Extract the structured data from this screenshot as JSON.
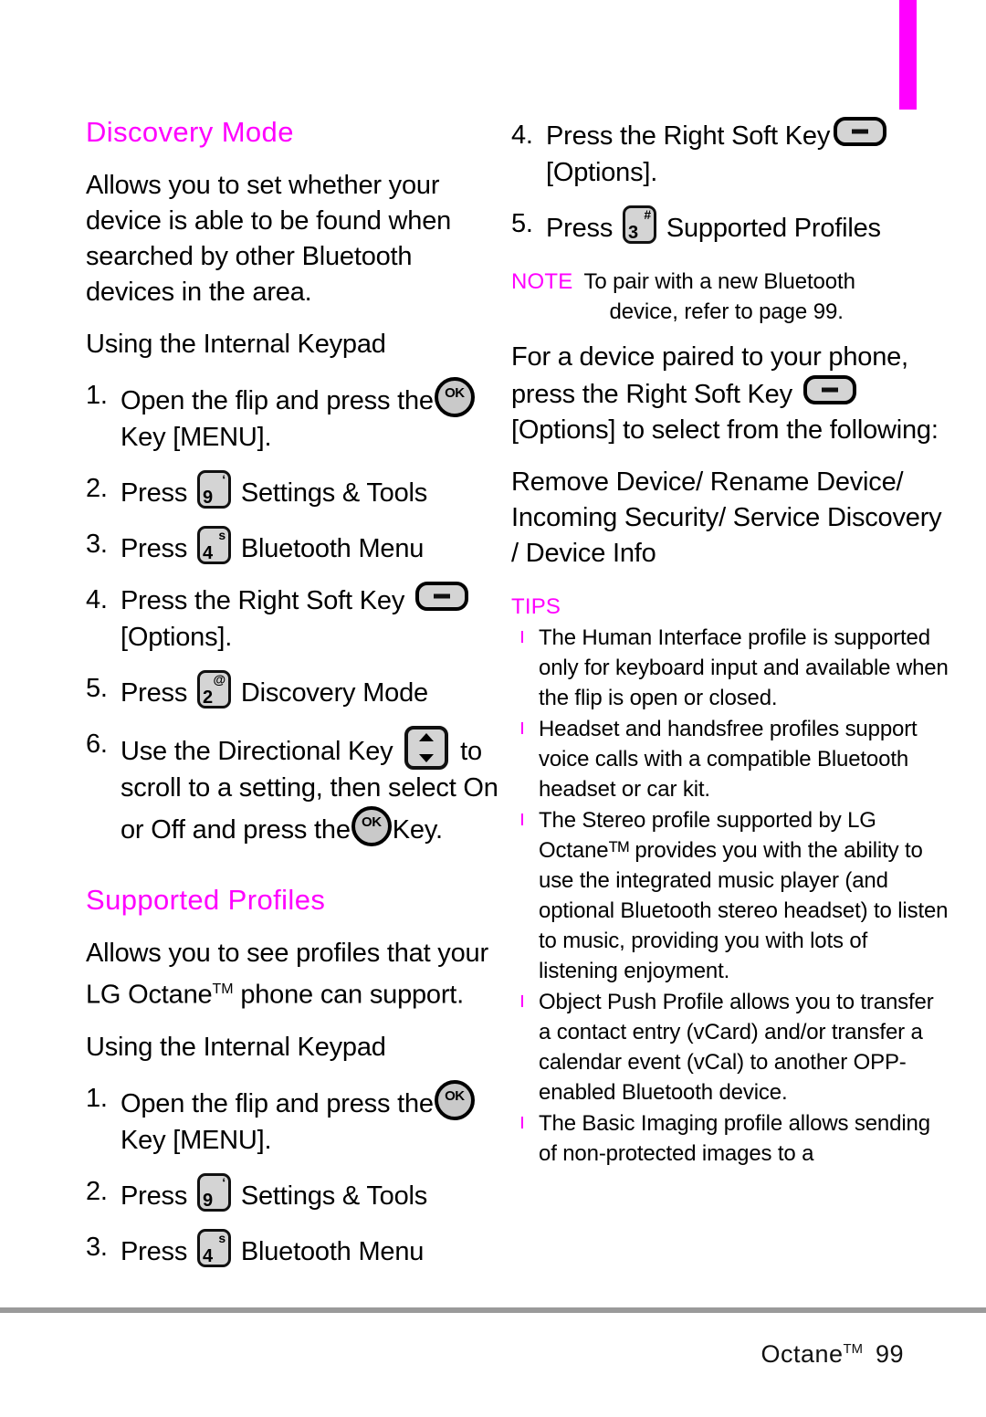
{
  "page": {
    "edge_tab_color": "#ff00ff",
    "accent_color": "#ff00ff",
    "text_color": "#000000"
  },
  "left_column": {
    "heading_1": "Discovery Mode",
    "intro_1": "Allows you to set whether your device is able to be found when searched by other Bluetooth devices in the area.",
    "subheading_1": "Using the Internal Keypad",
    "steps_1": [
      {
        "num": "1.",
        "text_before": "Open the flip and press the",
        "icon": "ok-key-icon",
        "icon_label": "OK",
        "text_after": "Key [MENU]."
      },
      {
        "num": "2.",
        "text_before": "Press",
        "icon": "number-key-icon",
        "key_digit": "9",
        "key_superscript": "‘",
        "text_after": "Settings & Tools"
      },
      {
        "num": "3.",
        "text_before": "Press",
        "icon": "number-key-icon",
        "key_digit": "4",
        "key_superscript": "s",
        "text_after": "Bluetooth Menu"
      },
      {
        "num": "4.",
        "text_before": "Press the Right Soft Key",
        "icon": "right-soft-key-icon",
        "text_after": "[Options]."
      },
      {
        "num": "5.",
        "text_before": "Press",
        "icon": "number-key-icon",
        "key_digit": "2",
        "key_superscript": "@",
        "text_after": "Discovery Mode"
      },
      {
        "num": "6.",
        "text_before": "Use the Directional Key",
        "icon": "directional-key-icon",
        "text_after": "to scroll to a setting, then select On or Off and press the",
        "icon_2": "ok-key-icon",
        "icon_2_label": "OK",
        "text_end": "Key."
      }
    ],
    "heading_2": "Supported Profiles",
    "intro_2_a": "Allows you to see profiles that your LG Octane",
    "intro_2_tm": "TM",
    "intro_2_b": " phone can support.",
    "subheading_2": "Using the Internal Keypad",
    "steps_2": [
      {
        "num": "1.",
        "text_before": "Open the flip and press the",
        "icon": "ok-key-icon",
        "icon_label": "OK",
        "text_after": "Key [MENU]."
      },
      {
        "num": "2.",
        "text_before": "Press",
        "icon": "number-key-icon",
        "key_digit": "9",
        "key_superscript": "‘",
        "text_after": "Settings & Tools"
      },
      {
        "num": "3.",
        "text_before": "Press",
        "icon": "number-key-icon",
        "key_digit": "4",
        "key_superscript": "s",
        "text_after": "Bluetooth Menu"
      }
    ]
  },
  "right_column": {
    "steps_continued": [
      {
        "num": "4.",
        "text_before": "Press the Right Soft Key",
        "icon": "right-soft-key-icon",
        "text_after": "[Options]."
      },
      {
        "num": "5.",
        "text_before": "Press",
        "icon": "number-key-icon",
        "key_digit": "3",
        "key_superscript": "#",
        "text_after": "Supported Profiles"
      }
    ],
    "note": {
      "label": "NOTE",
      "line_1": "To pair with a new Bluetooth",
      "line_2": "device, refer to page 99."
    },
    "paired_paragraph_a": "For a device paired to your phone, press the Right Soft Key",
    "paired_icon": "right-soft-key-icon",
    "paired_paragraph_b": "[Options] to select from the following:",
    "options_list": "Remove Device/ Rename Device/ Incoming Security/ Service Discovery / Device Info",
    "tips": {
      "label": "TIPS",
      "items": [
        "The Human Interface profile is supported only for keyboard input and available when the flip is open or closed.",
        "Headset and handsfree profiles support voice calls with a compatible Bluetooth headset or car kit.",
        "The Stereo profile supported by LG Octaneᵀᴹ provides you with the ability to use the integrated music player (and optional Bluetooth stereo headset) to listen to music, providing you with lots of listening enjoyment.",
        "Object Push Profile allows you to transfer a contact entry (vCard) and/or transfer a calendar event (vCal) to another OPP-enabled Bluetooth device.",
        "The Basic Imaging profile allows sending of non-protected images to a"
      ]
    }
  },
  "footer": {
    "product": "Octane",
    "trademark": "TM",
    "page_number": "99"
  }
}
